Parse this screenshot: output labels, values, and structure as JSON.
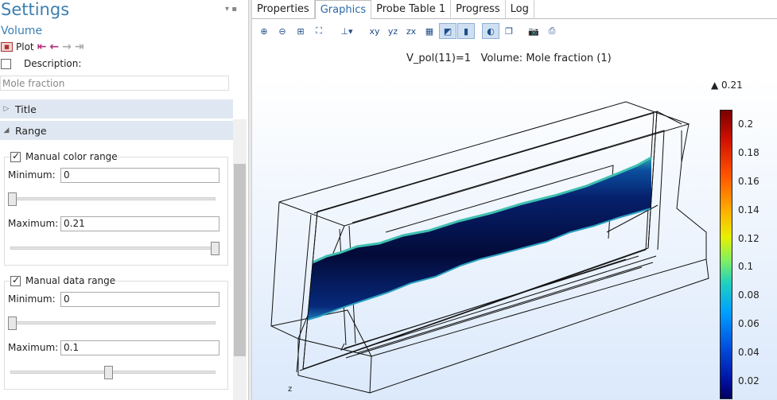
{
  "settings": {
    "title": "Settings",
    "subtitle": "Volume",
    "plot_label": "Plot",
    "description_label": "Description:",
    "description_value": "Mole fraction",
    "sections": {
      "title": "Title",
      "range": "Range"
    }
  },
  "color_range": {
    "label": "Manual color range",
    "min_label": "Minimum:",
    "min_value": "0",
    "max_label": "Maximum:",
    "max_value": "0.21"
  },
  "data_range": {
    "label": "Manual data range",
    "min_label": "Minimum:",
    "min_value": "0",
    "max_label": "Maximum:",
    "max_value": "0.1"
  },
  "tabs": [
    "Properties",
    "Graphics",
    "Probe Table 1",
    "Progress",
    "Log"
  ],
  "active_tab": "Graphics",
  "graphics": {
    "title": "V_pol(11)=1   Volume: Mole fraction (1)",
    "colorbar_max": "▲ 0.21",
    "colorbar_ticks": [
      "0.2",
      "0.18",
      "0.16",
      "0.14",
      "0.12",
      "0.1",
      "0.08",
      "0.06",
      "0.04",
      "0.02"
    ],
    "axis_label": "z"
  },
  "toolbar_icons": [
    "zoom-in-icon",
    "zoom-out-icon",
    "zoom-box-icon",
    "zoom-extents-icon",
    "axis-orientation-icon",
    "xy-view-icon",
    "yz-view-icon",
    "zx-view-icon",
    "grid-icon",
    "render-icon",
    "colorbar-toggle-icon",
    "scene-light-icon",
    "transparency-icon",
    "camera-icon",
    "print-icon"
  ],
  "colors": {
    "accent": "#3c7fb1",
    "section_bg": "#dfe8f2",
    "arrow": "#b0307a"
  }
}
